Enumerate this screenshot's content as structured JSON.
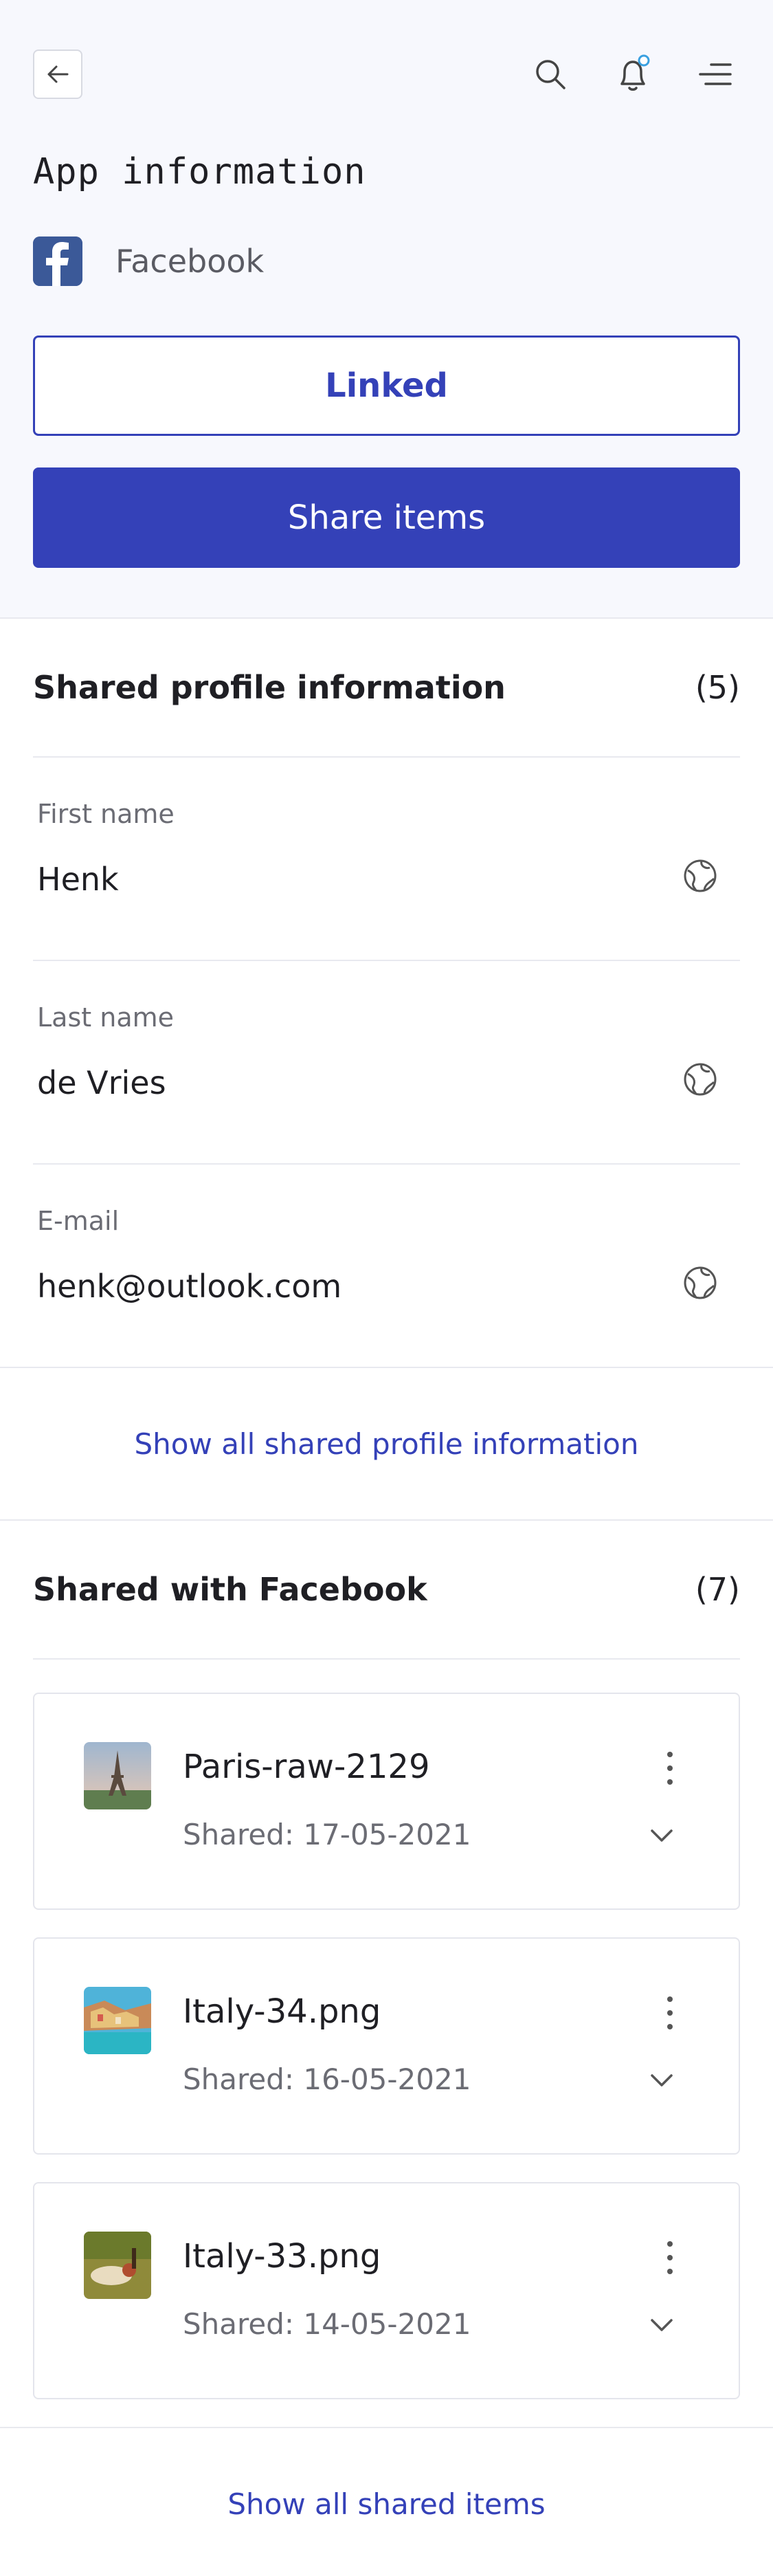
{
  "header": {
    "back_icon": "arrow-left-icon",
    "search_icon": "search-icon",
    "bell_icon": "bell-icon",
    "menu_icon": "menu-icon",
    "notification_dot_color": "#3aa0e0"
  },
  "page": {
    "title": "App information"
  },
  "app": {
    "icon": "facebook-logo",
    "name": "Facebook",
    "brand_color": "#3b5998"
  },
  "actions": {
    "linked_label": "Linked",
    "share_label": "Share items",
    "accent_color": "#3441b8"
  },
  "profile_section": {
    "title": "Shared profile information",
    "count": "(5)",
    "fields": [
      {
        "label": "First name",
        "value": "Henk",
        "icon": "globe-icon"
      },
      {
        "label": "Last name",
        "value": "de Vries",
        "icon": "globe-icon"
      },
      {
        "label": "E-mail",
        "value": "henk@outlook.com",
        "icon": "globe-icon"
      }
    ],
    "show_all_label": "Show all shared profile information"
  },
  "shared_section": {
    "title": "Shared with Facebook",
    "count": "(7)",
    "items": [
      {
        "name": "Paris-raw-2129",
        "date": "Shared: 17-05-2021"
      },
      {
        "name": "Italy-34.png",
        "date": "Shared: 16-05-2021"
      },
      {
        "name": "Italy-33.png",
        "date": "Shared: 14-05-2021"
      }
    ],
    "show_all_label": "Show all shared items"
  }
}
